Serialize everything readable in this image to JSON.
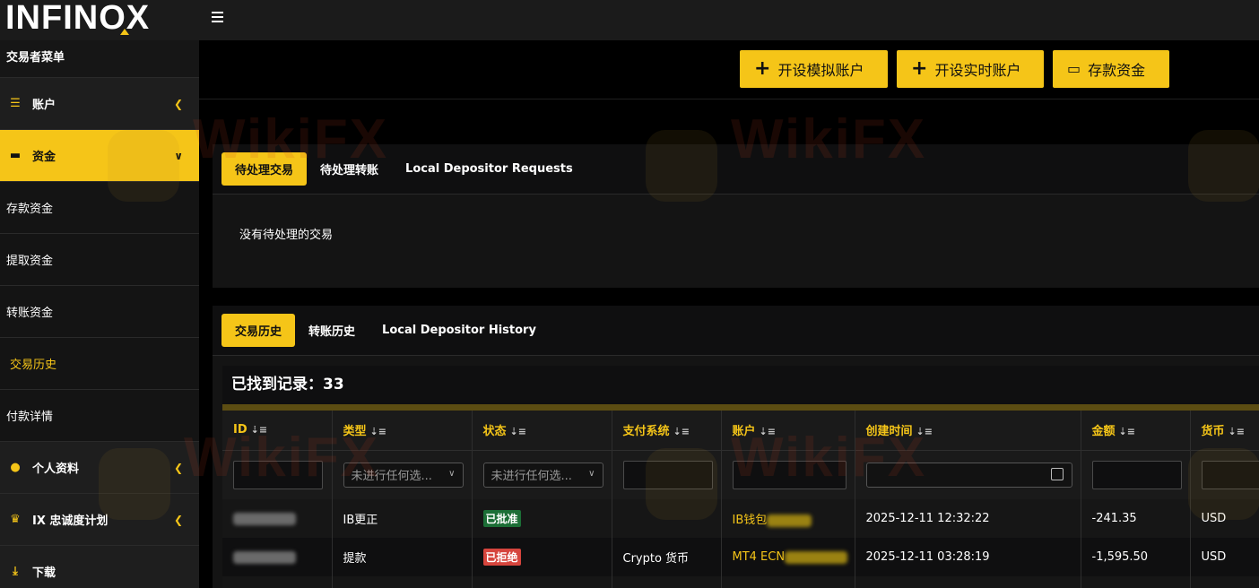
{
  "brand": {
    "logo_text_a": "INFIN",
    "logo_text_b": "OX"
  },
  "sidebar": {
    "title": "交易者菜单",
    "items": [
      {
        "label": "账户",
        "icon": "list-icon"
      },
      {
        "label": "资金",
        "icon": "wallet-icon",
        "active": true
      },
      {
        "label": "存款资金"
      },
      {
        "label": "提取资金"
      },
      {
        "label": "转账资金"
      },
      {
        "label": "交易历史",
        "current": true
      },
      {
        "label": "付款详情"
      },
      {
        "label": "个人资料",
        "icon": "user-icon"
      },
      {
        "label": "IX 忠诚度计划",
        "icon": "crown-icon"
      },
      {
        "label": "下载",
        "icon": "download-icon"
      }
    ]
  },
  "actions": {
    "demo": "开设模拟账户",
    "live": "开设实时账户",
    "deposit": "存款资金"
  },
  "pending": {
    "tabs": [
      "待处理交易",
      "待处理转账",
      "Local Depositor Requests"
    ],
    "empty": "没有待处理的交易"
  },
  "history": {
    "tabs": [
      "交易历史",
      "转账历史",
      "Local Depositor History"
    ],
    "records_label": "已找到记录：33",
    "columns": [
      "ID",
      "类型",
      "状态",
      "支付系统",
      "账户",
      "创建时间",
      "金额",
      "货币"
    ],
    "filter_placeholder": "未进行任何选...",
    "rows": [
      {
        "type": "IB更正",
        "status": "已批准",
        "status_kind": "ok",
        "system": "",
        "account": "IB钱包",
        "created": "2025-12-11 12:32:22",
        "amount": "-241.35",
        "currency": "USD"
      },
      {
        "type": "提款",
        "status": "已拒绝",
        "status_kind": "rej",
        "system": "Crypto 货币",
        "account": "MT4 ECN",
        "created": "2025-12-11 03:28:19",
        "amount": "-1,595.50",
        "currency": "USD"
      }
    ]
  },
  "watermark": "WikiFX",
  "colors": {
    "accent": "#f5c518",
    "approved": "#1c6e36",
    "rejected": "#d6453d"
  }
}
